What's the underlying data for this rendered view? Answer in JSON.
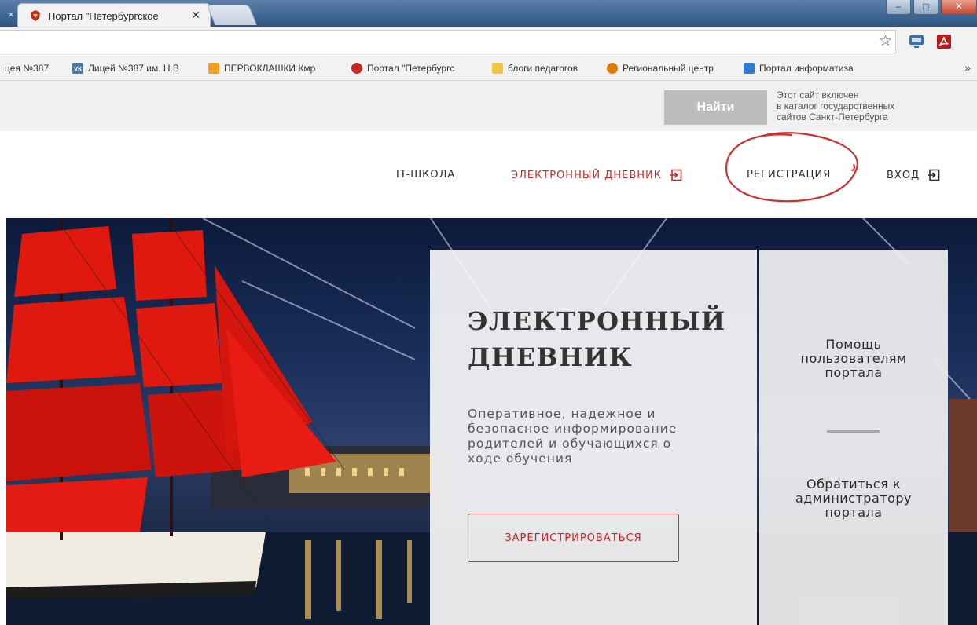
{
  "browser": {
    "prev_tab_close": "×",
    "active_tab": {
      "title": "Портал \"Петербургское",
      "close": "✕"
    },
    "toolbar": {
      "star": "☆"
    },
    "bookmarks": [
      {
        "label": "цея №387",
        "icon": "none",
        "color": ""
      },
      {
        "label": "Лицей №387 им. Н.В",
        "icon": "vk-icon",
        "color": "#4a76a8"
      },
      {
        "label": "ПЕРВОКЛАШКИ Кмр",
        "icon": "bookmark-site-icon",
        "color": "#f0a020"
      },
      {
        "label": "Портал \"Петербургс",
        "icon": "spb-crest-icon",
        "color": "#c62828"
      },
      {
        "label": "блоги педагогов",
        "icon": "folder-icon",
        "color": "#f5c542"
      },
      {
        "label": "Региональный центр",
        "icon": "rc-logo-icon",
        "color": "#e07a00"
      },
      {
        "label": "Портал информатиза",
        "icon": "portal-icon",
        "color": "#2e7cd6"
      }
    ],
    "bookmarks_more": "»"
  },
  "page": {
    "search": {
      "placeholder": "",
      "value": "",
      "button": "Найти"
    },
    "catalog_note": [
      "Этот сайт включен",
      "в каталог государственных",
      "сайтов Санкт-Петербурга"
    ],
    "nav": {
      "it_school": "IT-ШКОЛА",
      "e_diary": "ЭЛЕКТРОННЫЙ ДНЕВНИК",
      "registration": "РЕГИСТРАЦИЯ",
      "login": "ВХОД"
    },
    "hero": {
      "title_line1": "ЭЛЕКТРОННЫЙ",
      "title_line2": "ДНЕВНИК",
      "desc_lines": [
        "Оперативное, надежное и",
        "безопасное информирование",
        "родителей и обучающихся о",
        "ходе обучения"
      ],
      "register_button": "ЗАРЕГИСТРИРОВАТЬСЯ"
    },
    "side": {
      "help": [
        "Помощь",
        "пользователям",
        "портала"
      ],
      "admin": [
        "Обратиться к",
        "администратору",
        "портала"
      ]
    }
  },
  "colors": {
    "accent_red": "#c62828",
    "annotation_red": "#d32f2f",
    "button_gray": "#bdbdbd"
  }
}
